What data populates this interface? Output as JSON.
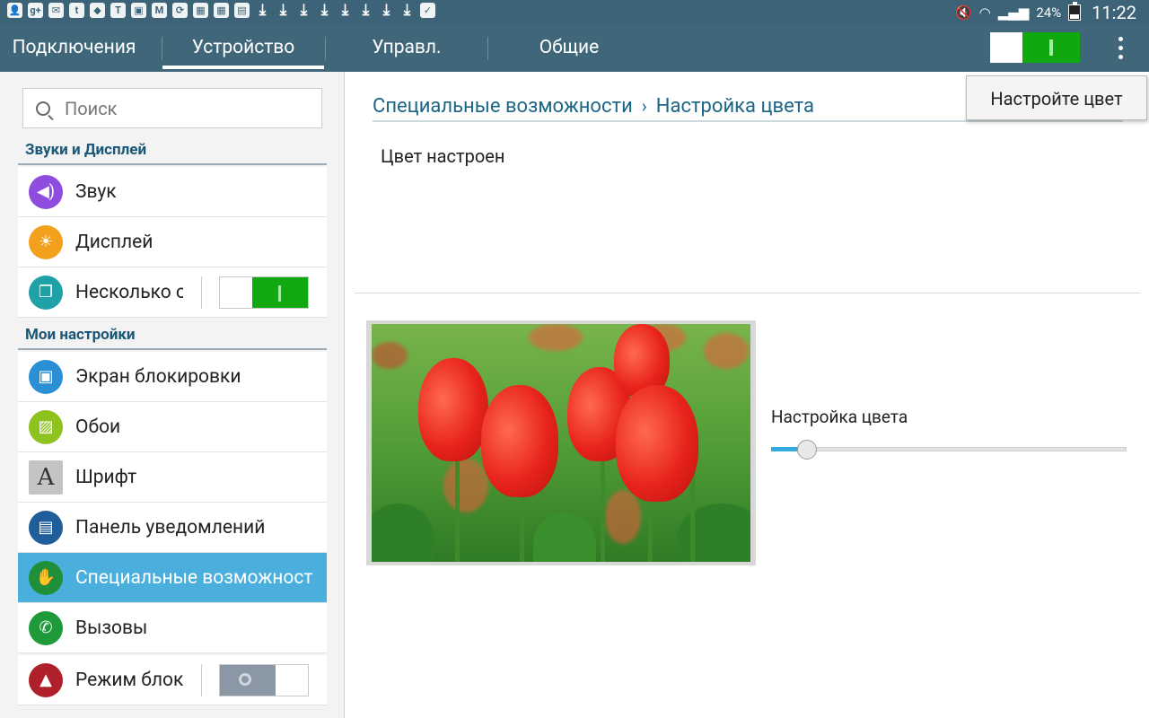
{
  "statusbar": {
    "battery": "24%",
    "time": "11:22",
    "notification_icons": [
      "person-icon",
      "google-plus-icon",
      "mail-icon",
      "twitter-icon",
      "dropbox-icon",
      "nyt-icon",
      "image-icon",
      "gmail-icon",
      "sync-icon",
      "store-icon",
      "store-icon",
      "document-icon",
      "download-icon",
      "download-icon",
      "download-icon",
      "download-icon",
      "download-icon",
      "download-icon",
      "download-icon",
      "download-icon",
      "bag-icon"
    ]
  },
  "tabs": [
    {
      "label": "Подключения",
      "active": false
    },
    {
      "label": "Устройство",
      "active": true
    },
    {
      "label": "Управл.",
      "active": false
    },
    {
      "label": "Общие",
      "active": false
    }
  ],
  "master_switch_on": true,
  "sidebar": {
    "search_placeholder": "Поиск",
    "sections": [
      {
        "header": "Звуки и Дисплей"
      },
      {
        "header": "Мои настройки"
      }
    ],
    "items": [
      {
        "label": "Звук",
        "icon": "speaker-icon",
        "color": "#8f4de0"
      },
      {
        "label": "Дисплей",
        "icon": "brightness-icon",
        "color": "#f3a11d"
      },
      {
        "label": "Несколько окон",
        "icon": "multi-window-icon",
        "color": "#1ea2a8",
        "switch": "on"
      },
      {
        "label": "Экран блокировки",
        "icon": "lock-screen-icon",
        "color": "#2a8fd4"
      },
      {
        "label": "Обои",
        "icon": "wallpaper-icon",
        "color": "#8dc21f"
      },
      {
        "label": "Шрифт",
        "icon": "font-icon",
        "color": "#b0b0b0"
      },
      {
        "label": "Панель уведомлений",
        "icon": "notification-panel-icon",
        "color": "#1f5e9a"
      },
      {
        "label": "Специальные возможности",
        "icon": "hand-icon",
        "color": "#1f8f3a",
        "active": true
      },
      {
        "label": "Вызовы",
        "icon": "phone-icon",
        "color": "#1f9a3a"
      },
      {
        "label": "Режим блокировки",
        "icon": "block-mode-icon",
        "color": "#b0202a",
        "switch": "off"
      }
    ]
  },
  "content": {
    "breadcrumb_parent": "Специальные возможности",
    "breadcrumb_current": "Настройка цвета",
    "status_text": "Цвет настроен",
    "slider_label": "Настройка цвета",
    "slider_value": 0.1,
    "popup_label": "Настройте цвет"
  }
}
